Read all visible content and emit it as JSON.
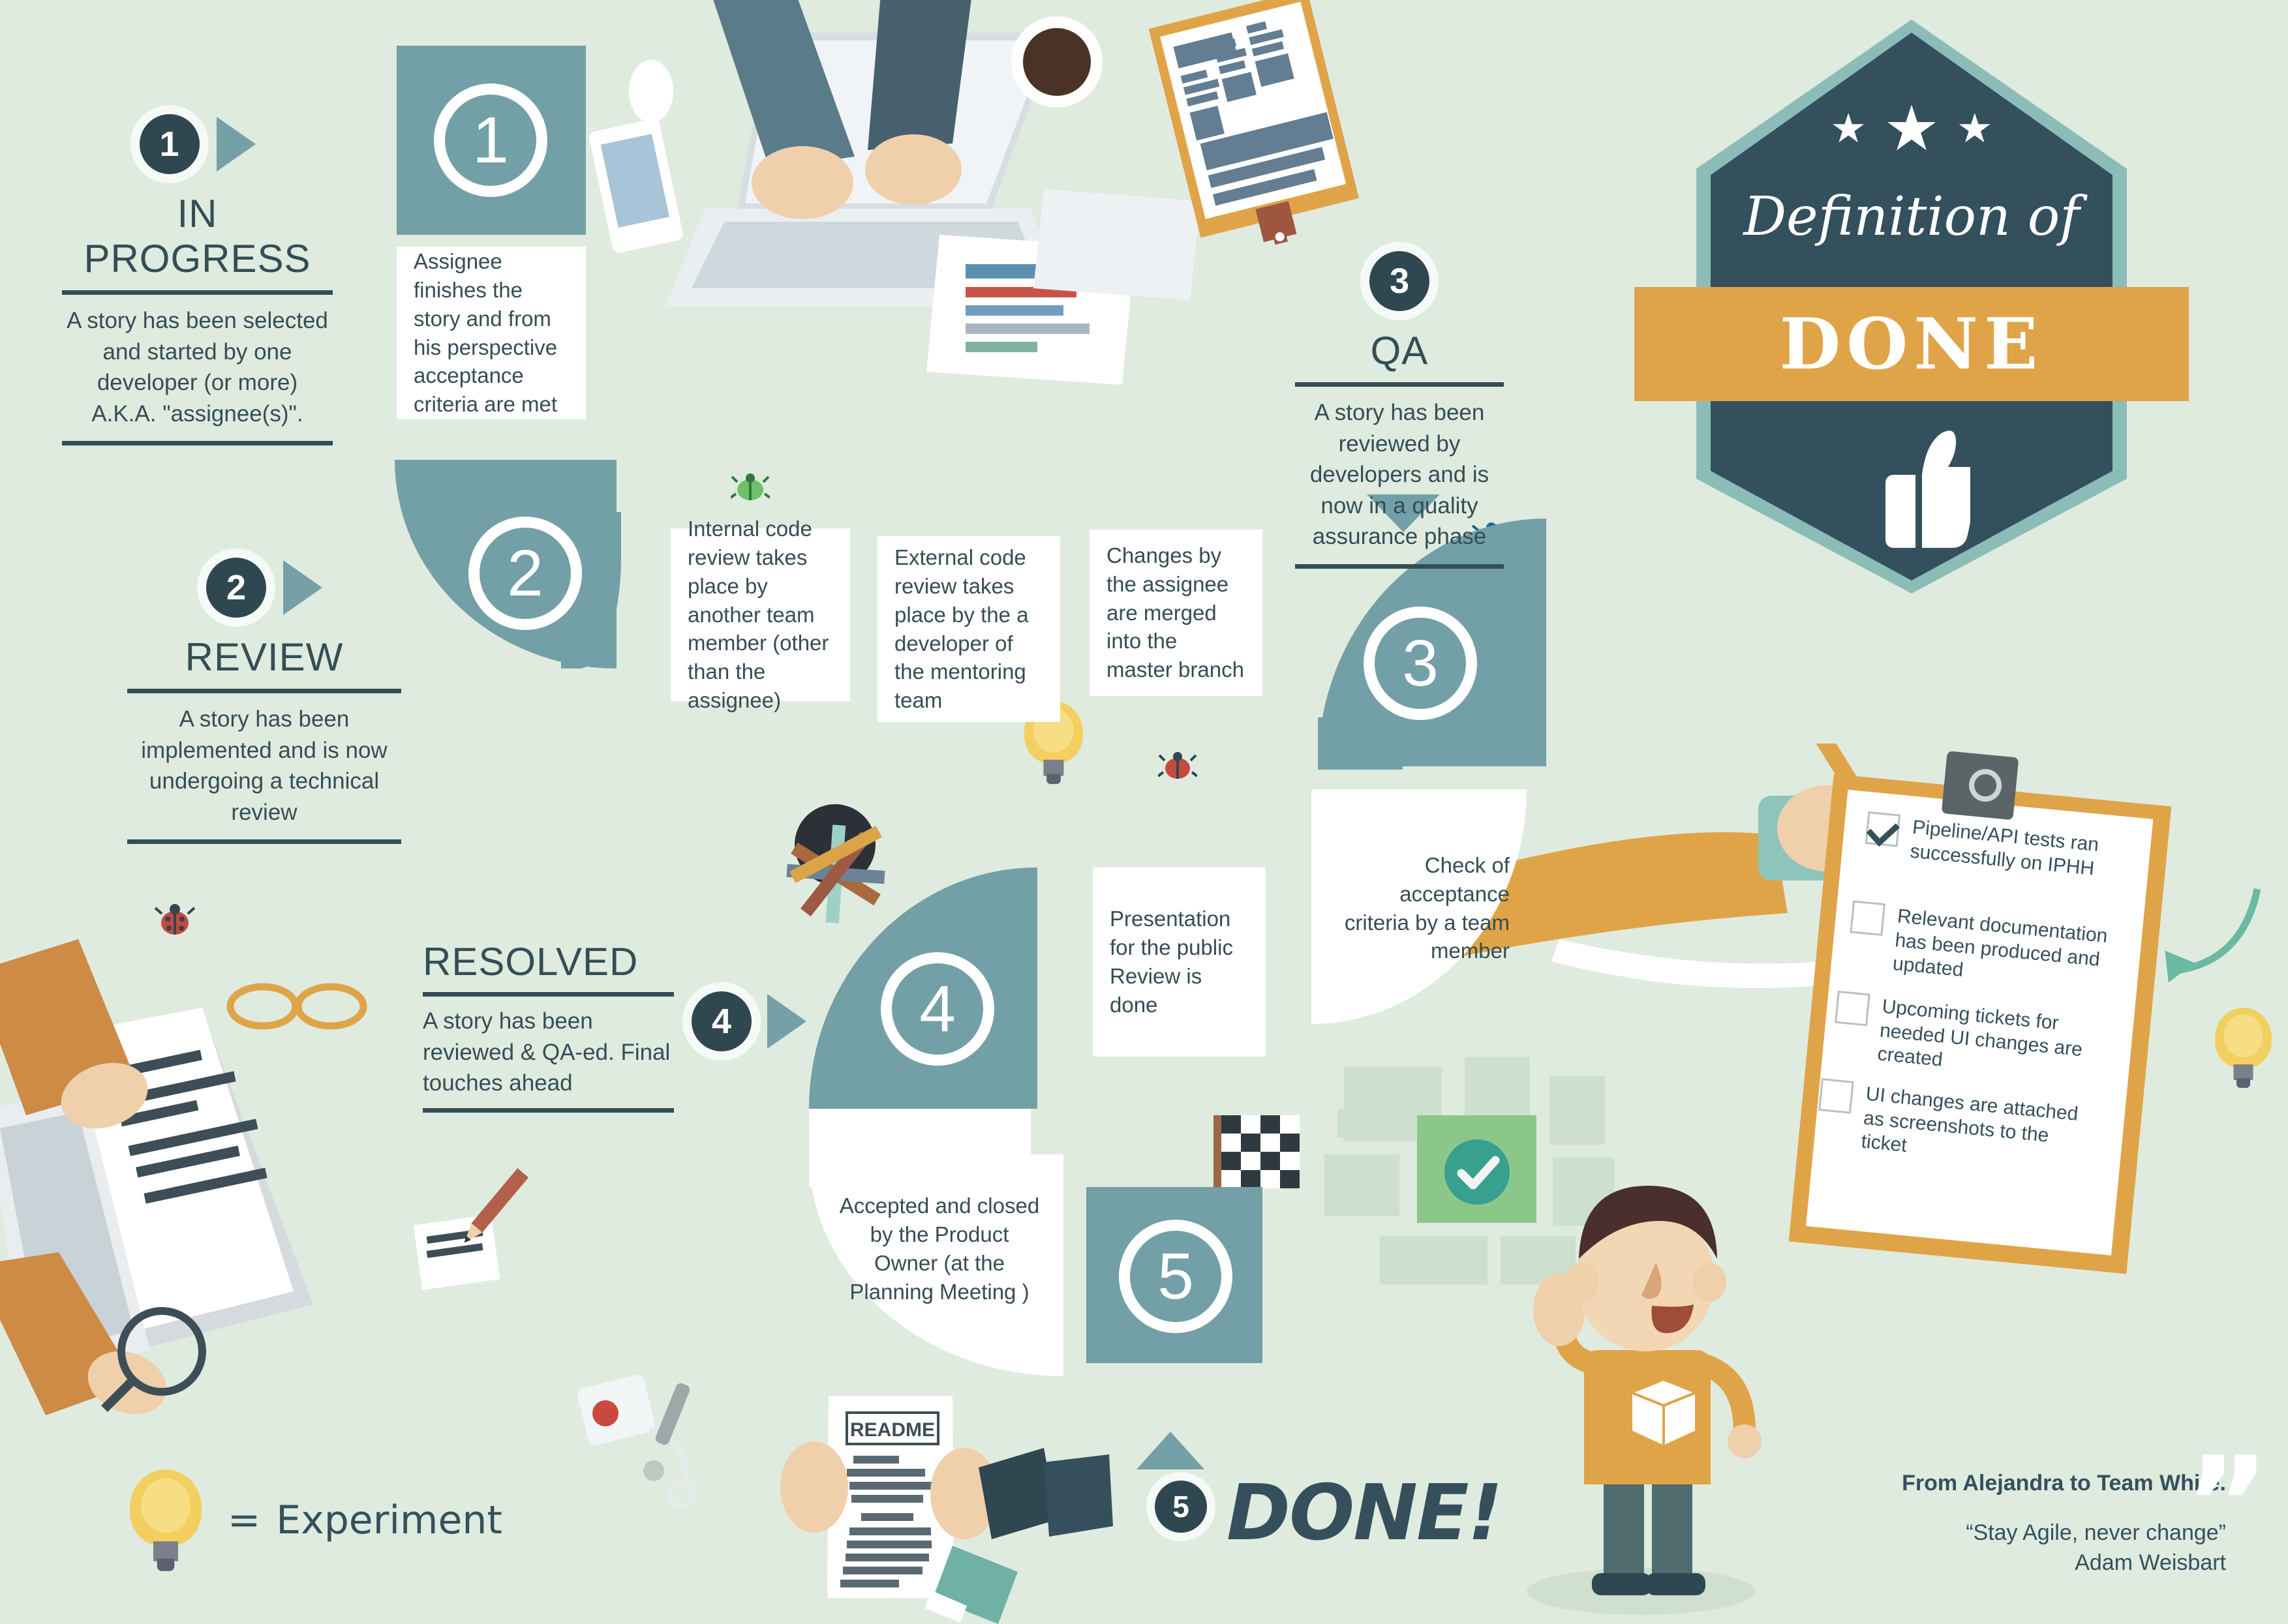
{
  "page": {
    "background_color": "#dfebdf",
    "accent_teal": "#73a0a6",
    "accent_dark": "#35505c",
    "accent_orange": "#e0a448"
  },
  "badge": {
    "script_title": "Definition of",
    "ribbon_title": "DONE",
    "stars": [
      "★",
      "★",
      "★"
    ],
    "thumb_icon": "thumbs-up-icon"
  },
  "steps": [
    {
      "number": "1",
      "title": "IN PROGRESS",
      "description": "A story has been selected and started by one developer (or more) A.K.A. \"assignee(s)\"."
    },
    {
      "number": "2",
      "title": "REVIEW",
      "description": "A story has been implemented and is now undergoing a technical review"
    },
    {
      "number": "3",
      "title": "QA",
      "description": "A story has been reviewed by developers and is now in a quality assurance phase"
    },
    {
      "number": "4",
      "title": "RESOLVED",
      "description": "A story has been reviewed & QA-ed. Final touches ahead"
    },
    {
      "number": "5",
      "title": "DONE!",
      "description": ""
    }
  ],
  "cards": [
    {
      "id": "assignee-finishes",
      "text": "Assignee finishes the story and from his perspective acceptance criteria are met"
    },
    {
      "id": "internal-review",
      "text": "Internal code review takes place by another team member (other than the assignee)"
    },
    {
      "id": "external-review",
      "text": "External code review takes place by the a developer of the mentoring team"
    },
    {
      "id": "merge-master",
      "text": "Changes by the assignee are merged into the master branch"
    },
    {
      "id": "acceptance-check",
      "text": "Check of acceptance criteria by a team member"
    },
    {
      "id": "presentation",
      "text": "Presentation for the public Review is done"
    },
    {
      "id": "accepted-closed",
      "text": "Accepted and closed by the Product Owner (at the Planning Meeting )"
    }
  ],
  "checklist": {
    "items": [
      {
        "label": "Pipeline/API tests ran successfully on IPHH",
        "checked": true
      },
      {
        "label": "Relevant documentation has been produced and updated",
        "checked": false
      },
      {
        "label": "Upcoming tickets for needed UI changes are created",
        "checked": false
      },
      {
        "label": "UI changes are attached as screenshots to the ticket",
        "checked": false
      }
    ]
  },
  "legend": {
    "equals_sign": "=",
    "experiment_label": "Experiment",
    "bulb_icon": "lightbulb-icon"
  },
  "footer": {
    "from_line": "From Alejandra to Team White.",
    "quote": "“Stay Agile, never change”",
    "author": "Adam Weisbart",
    "quote_mark": "”"
  },
  "illustrations": {
    "readme_label": "README",
    "done_label": "DONE!",
    "number_5_badge": "5"
  }
}
